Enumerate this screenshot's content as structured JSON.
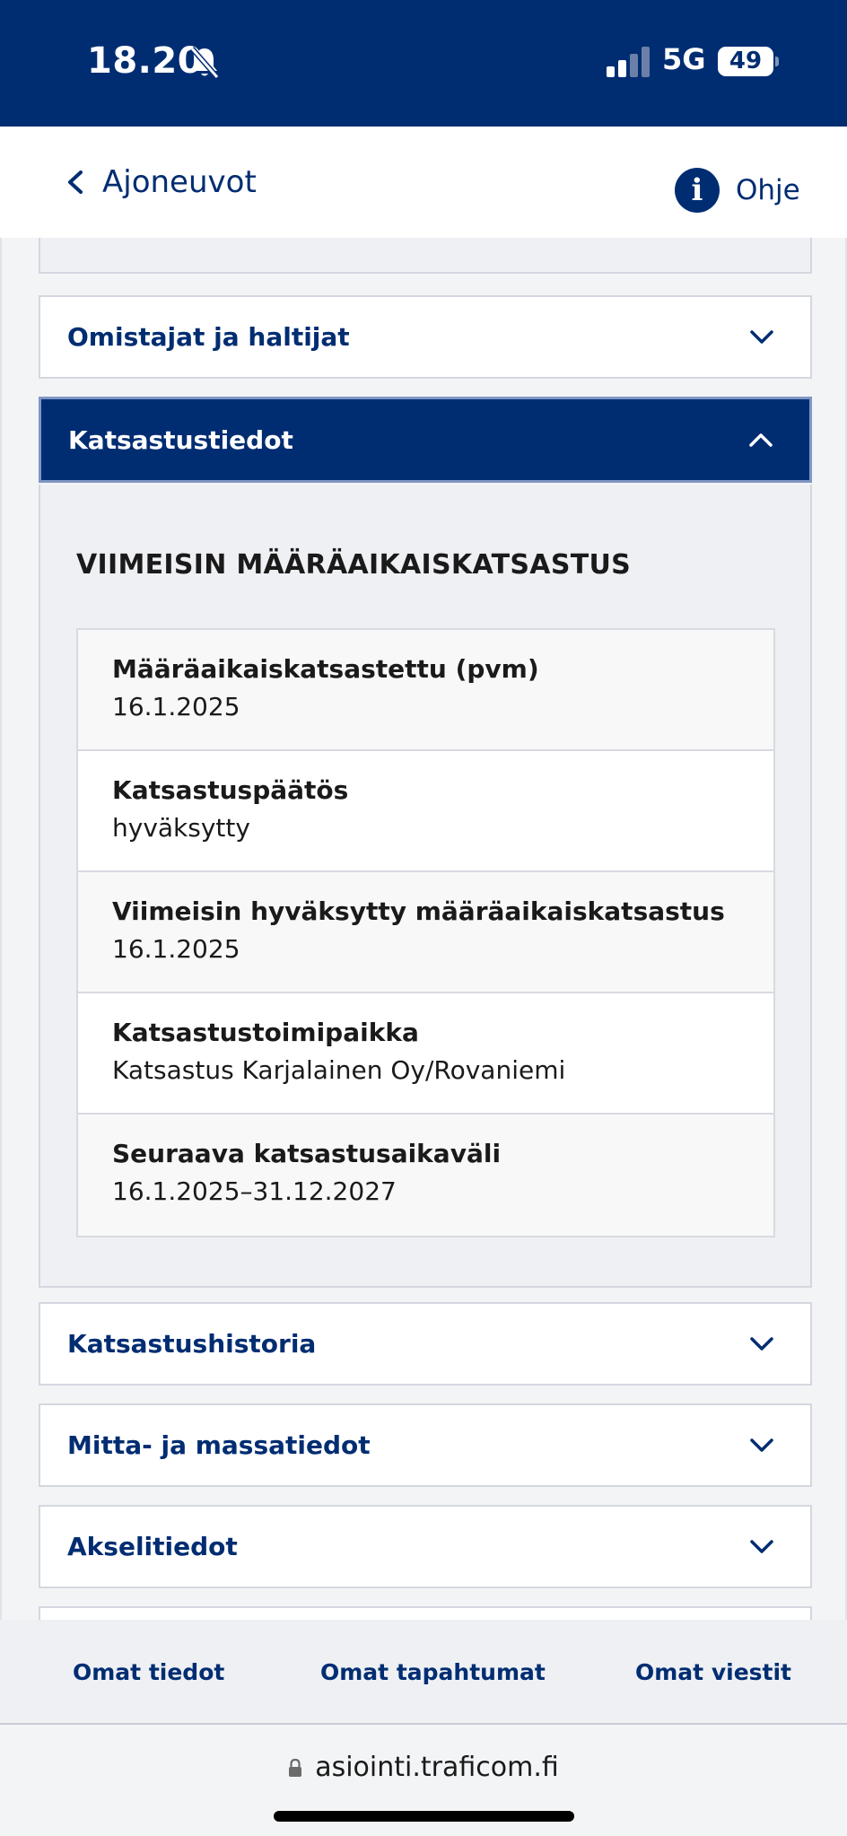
{
  "status_bar": {
    "time": "18.20",
    "network": "5G",
    "battery": "49"
  },
  "header": {
    "back_label": "Ajoneuvot",
    "help_label": "Ohje"
  },
  "accordions": {
    "owners": "Omistajat ja haltijat",
    "inspection": "Katsastustiedot",
    "inspection_history": "Katsastushistoria",
    "dimensions": "Mitta- ja massatiedot",
    "axles": "Akselitiedot"
  },
  "inspection_panel": {
    "section_title": "VIIMEISIN MÄÄRÄAIKAISKATSASTUS",
    "rows": [
      {
        "label": "Määräaikaiskatsastettu (pvm)",
        "value": "16.1.2025"
      },
      {
        "label": "Katsastuspäätös",
        "value": "hyväksytty"
      },
      {
        "label": "Viimeisin hyväksytty määräaikaiskatsastus",
        "value": "16.1.2025"
      },
      {
        "label": "Katsastustoimipaikka",
        "value": "Katsastus Karjalainen Oy/Rovaniemi"
      },
      {
        "label": "Seuraava katsastusaikaväli",
        "value": "16.1.2025–31.12.2027"
      }
    ]
  },
  "bottom_nav": {
    "my_info": "Omat tiedot",
    "my_events": "Omat tapahtumat",
    "my_messages": "Omat viestit"
  },
  "browser": {
    "url": "asiointi.traficom.fi"
  },
  "colors": {
    "brand": "#002d72",
    "panel_bg": "#eff0f4"
  }
}
